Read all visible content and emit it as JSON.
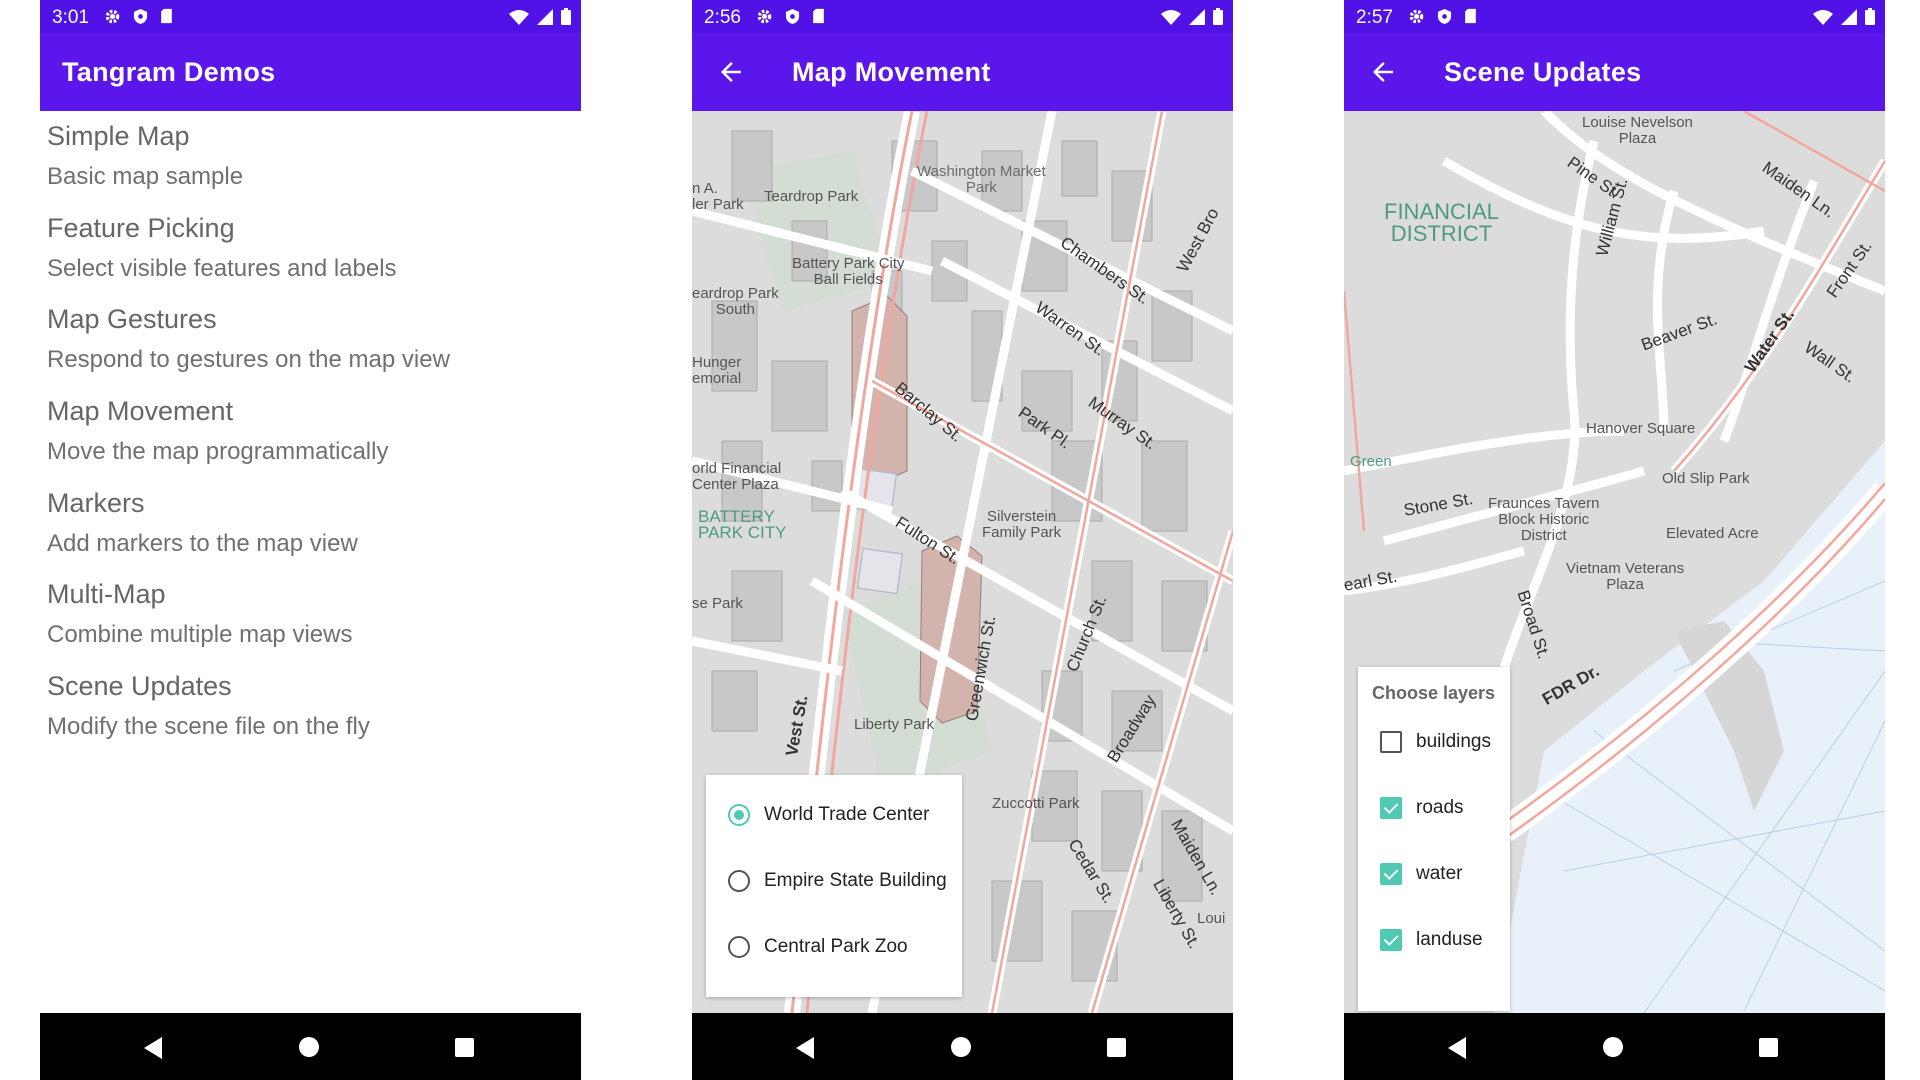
{
  "phone1": {
    "status_time": "3:01",
    "title": "Tangram Demos",
    "demos": [
      {
        "title": "Simple Map",
        "subtitle": "Basic map sample"
      },
      {
        "title": "Feature Picking",
        "subtitle": "Select visible features and labels"
      },
      {
        "title": "Map Gestures",
        "subtitle": "Respond to gestures on the map view"
      },
      {
        "title": "Map Movement",
        "subtitle": "Move the map programmatically"
      },
      {
        "title": "Markers",
        "subtitle": "Add markers to the map view"
      },
      {
        "title": "Multi-Map",
        "subtitle": "Combine multiple map views"
      },
      {
        "title": "Scene Updates",
        "subtitle": "Modify the scene file on the fly"
      }
    ]
  },
  "phone2": {
    "status_time": "2:56",
    "title": "Map Movement",
    "locations": [
      {
        "label": "World Trade Center",
        "selected": true
      },
      {
        "label": "Empire State Building",
        "selected": false
      },
      {
        "label": "Central Park Zoo",
        "selected": false
      }
    ],
    "map_labels": {
      "washington_market": "Washington Market\nPark",
      "teardrop_park": "Teardrop Park",
      "battery_park_fields": "Battery Park City\nBall Fields",
      "teardrop_south": "eardrop Park\nSouth",
      "hunger": "Hunger\nemorial",
      "world_financial": "orld Financial\nCenter Plaza",
      "battery_park_city": "BATTERY\nPARK CITY",
      "silverstein": "Silverstein\nFamily Park",
      "liberty_park": "Liberty Park",
      "zuccotti": "Zuccotti Park",
      "rose_park": "se Park",
      "na_park": "n A.\nler Park",
      "chambers": "Chambers St.",
      "warren": "Warren St.",
      "murray": "Murray St.",
      "park_pl": "Park Pl.",
      "barclay": "Barclay St.",
      "fulton": "Fulton St.",
      "church": "Church St.",
      "greenwich": "Greenwich St.",
      "broadway": "Broadway",
      "west_st": "Vest St.",
      "west_broadway": "West Bro",
      "cedar": "Cedar St.",
      "liberty": "Liberty St.",
      "maiden": "Maiden Ln.",
      "loui": "Loui"
    }
  },
  "phone3": {
    "status_time": "2:57",
    "title": "Scene Updates",
    "layer_title": "Choose layers",
    "layers": [
      {
        "label": "buildings",
        "checked": false
      },
      {
        "label": "roads",
        "checked": true
      },
      {
        "label": "water",
        "checked": true
      },
      {
        "label": "landuse",
        "checked": true
      }
    ],
    "map_labels": {
      "louise": "Louise Nevelson\nPlaza",
      "financial": "FINANCIAL\nDISTRICT",
      "pine": "Pine St.",
      "maiden": "Maiden Ln.",
      "william": "William St.",
      "front": "Front St.",
      "beaver": "Beaver St.",
      "water_st": "Water St.",
      "wall": "Wall St.",
      "hanover": "Hanover Square",
      "green": "Green",
      "stone": "Stone St.",
      "fraunces": "Fraunces Tavern\nBlock Historic\nDistrict",
      "old_slip": "Old Slip Park",
      "elevated": "Elevated Acre",
      "vietnam": "Vietnam Veterans\nPlaza",
      "pearl": "earl St.",
      "broad": "Broad St.",
      "fdr": "FDR Dr."
    }
  },
  "colors": {
    "status_bar": "#5012e6",
    "app_bar": "#5b16ec",
    "accent": "#4fc9b2",
    "map_land": "#dcdcdc",
    "map_water": "#e8f1fa",
    "road_major": "#f4a79d"
  }
}
